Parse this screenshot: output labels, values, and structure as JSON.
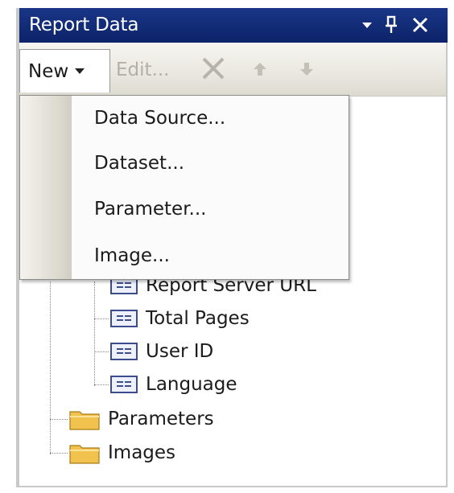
{
  "window": {
    "title": "Report Data",
    "controls": [
      "menu-arrow-icon",
      "pin-icon",
      "close-icon"
    ]
  },
  "toolbar": {
    "new_label": "New",
    "edit_label": "Edit...",
    "icons": [
      "delete-x-icon",
      "move-up-icon",
      "move-down-icon"
    ]
  },
  "menu": {
    "items": [
      {
        "label": "Data Source..."
      },
      {
        "label": "Dataset..."
      },
      {
        "label": "Parameter..."
      },
      {
        "label": "Image..."
      }
    ]
  },
  "tree": {
    "fields": [
      {
        "label": "Report Server URL"
      },
      {
        "label": "Total Pages"
      },
      {
        "label": "User ID"
      },
      {
        "label": "Language"
      }
    ],
    "folders": [
      {
        "label": "Parameters"
      },
      {
        "label": "Images"
      }
    ]
  },
  "colors": {
    "title_bar": "#0d2369",
    "toolbar": "#e9e7df",
    "folder": "#f2c24f",
    "field_icon_border": "#3b4d8c"
  }
}
